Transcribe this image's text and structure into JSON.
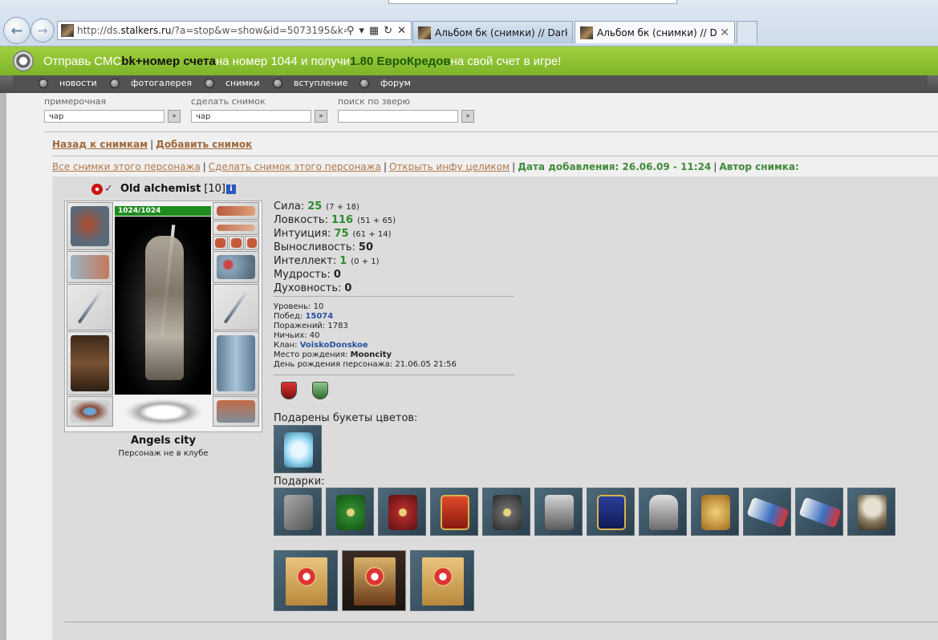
{
  "browser": {
    "url_prefix": "http://ds.",
    "url_domain": "stalkers.ru",
    "url_rest": "/?a=stop&w=show&id=5073195&k=",
    "tabs": [
      {
        "title": "Альбом бк (снимки) // DarkS..."
      },
      {
        "title": "Альбом бк (снимки) // Da..."
      }
    ]
  },
  "promo": {
    "t1": "Отправь СМС ",
    "t2": "bk+номер счета",
    "t3": " на номер 1044 и получи ",
    "t4": "1.80 ЕвроКредов",
    "t5": " на свой счет в игре!"
  },
  "nav": {
    "items": [
      "новости",
      "фотогалерея",
      "снимки",
      "вступление",
      "форум"
    ]
  },
  "search": {
    "groups": [
      {
        "label": "примерочная",
        "value": "чар"
      },
      {
        "label": "сделать снимок",
        "value": "чар"
      },
      {
        "label": "поиск по зверю",
        "value": ""
      }
    ],
    "go_glyph": "»"
  },
  "backlinks": {
    "back": "Назад к снимкам",
    "sep": "|",
    "add": "Добавить снимок"
  },
  "links": {
    "all": "Все снимки этого персонажа",
    "make": "Сделать снимок этого персонажа",
    "open": "Открыть инфу целиком",
    "date": "Дата добавления: 26.06.09 - 11:24",
    "author": "Автор снимка:",
    "sep": "|"
  },
  "character": {
    "name": "Old alchemist",
    "level": "[10]",
    "info_glyph": "i",
    "hp": "1024/1024",
    "guild": "Angels city",
    "club": "Персонаж не в клубе"
  },
  "stats": [
    {
      "label": "Сила:",
      "value": "25",
      "detail": "(7 + 18)",
      "green": true
    },
    {
      "label": "Ловкость:",
      "value": "116",
      "detail": "(51 + 65)",
      "green": true
    },
    {
      "label": "Интуиция:",
      "value": "75",
      "detail": "(61 + 14)",
      "green": true
    },
    {
      "label": "Выносливость:",
      "value": "50",
      "detail": "",
      "green": false
    },
    {
      "label": "Интеллект:",
      "value": "1",
      "detail": "(0 + 1)",
      "green": true
    },
    {
      "label": "Мудрость:",
      "value": "0",
      "detail": "",
      "green": false
    },
    {
      "label": "Духовность:",
      "value": "0",
      "detail": "",
      "green": false
    }
  ],
  "info": {
    "level_label": "Уровень:",
    "level": "10",
    "wins_label": "Побед:",
    "wins": "15074",
    "losses_label": "Поражений:",
    "losses": "1783",
    "draws_label": "Ничьих:",
    "draws": "40",
    "clan_label": "Клан:",
    "clan": "VoiskoDonskoe",
    "birthplace_label": "Место рождения:",
    "birthplace": "Mooncity",
    "birthday_label": "День рождения персонажа:",
    "birthday": "21.06.05 21:56"
  },
  "flowers_label": "Подарены букеты цветов:",
  "gifts_label": "Подарки:",
  "colors": {
    "promo": "#8cc133",
    "link": "#a0683a",
    "green_text": "#3f8b3a",
    "blue_text": "#2850a0"
  }
}
